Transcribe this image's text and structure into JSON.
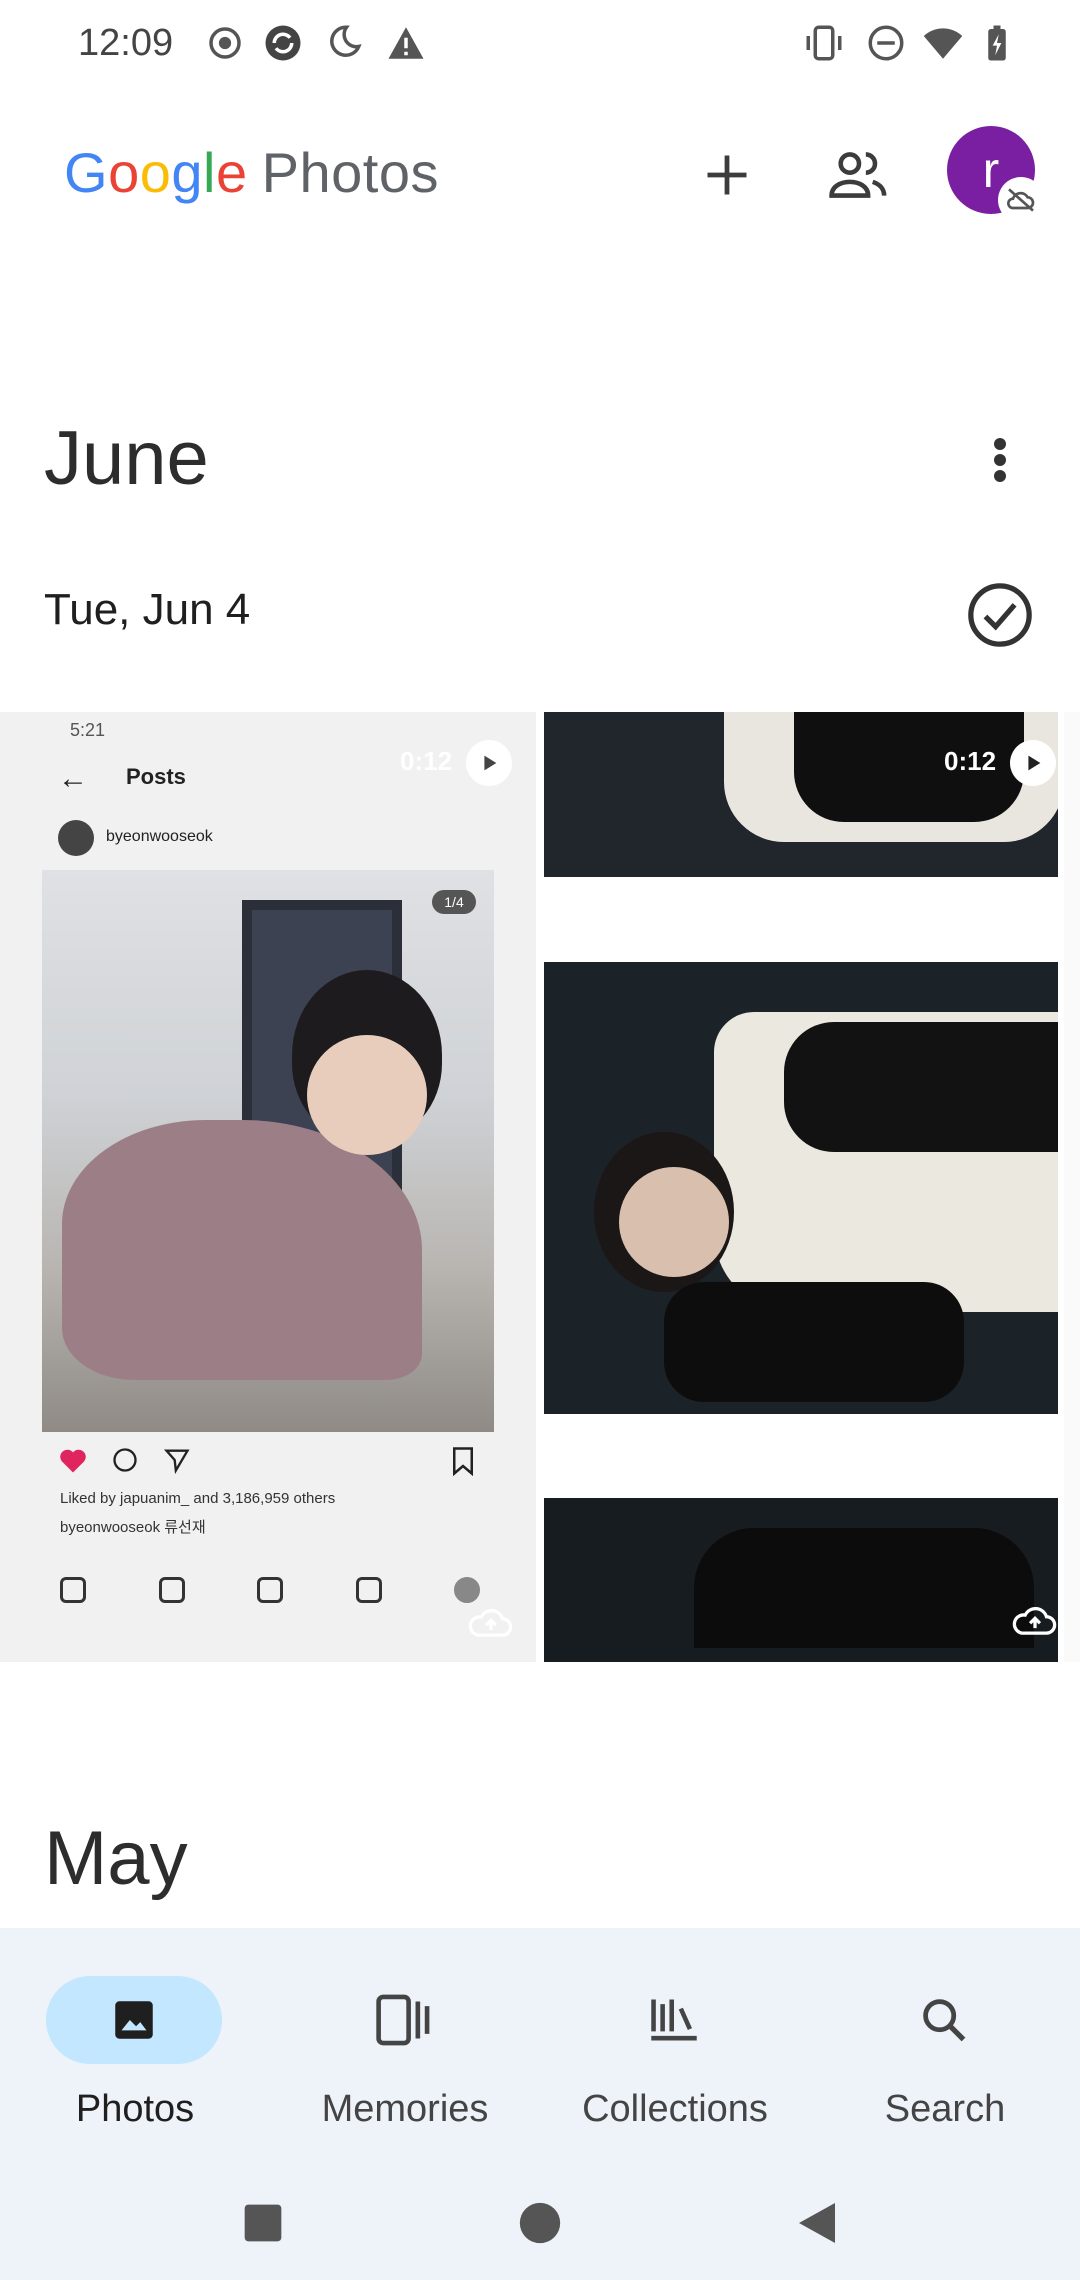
{
  "status_bar": {
    "time": "12:09",
    "left_icons": [
      "record-icon",
      "sync-icon",
      "night-mode-icon",
      "warning-icon"
    ],
    "right_icons": [
      "vibrate-icon",
      "do-not-disturb-icon",
      "wifi-icon",
      "battery-icon"
    ]
  },
  "app_bar": {
    "logo_g": "G",
    "logo_o1": "o",
    "logo_o2": "o",
    "logo_g2": "g",
    "logo_l": "l",
    "logo_e": "e",
    "logo_product": "Photos",
    "avatar_initial": "r",
    "colors": {
      "avatar_bg": "#7B1FA2"
    }
  },
  "sections": {
    "june": {
      "title": "June",
      "date": "Tue, Jun 4"
    },
    "may": {
      "title": "May"
    }
  },
  "grid": {
    "tile_a": {
      "duration": "0:12",
      "inner": {
        "status": "5:21",
        "title": "Posts",
        "user": "byeonwooseok",
        "badge": "1/4",
        "likes": "Liked by japuanim_ and 3,186,959 others",
        "caption": "byeonwooseok 류선재"
      }
    },
    "tile_b": {
      "duration": "0:12"
    }
  },
  "bottom_nav": {
    "items": [
      {
        "label": "Photos",
        "icon": "photo-icon",
        "active": true
      },
      {
        "label": "Memories",
        "icon": "memories-icon",
        "active": false
      },
      {
        "label": "Collections",
        "icon": "collections-icon",
        "active": false
      },
      {
        "label": "Search",
        "icon": "search-icon",
        "active": false
      }
    ],
    "colors": {
      "active_pill": "#c2e7ff",
      "background": "#eef2f9"
    }
  }
}
